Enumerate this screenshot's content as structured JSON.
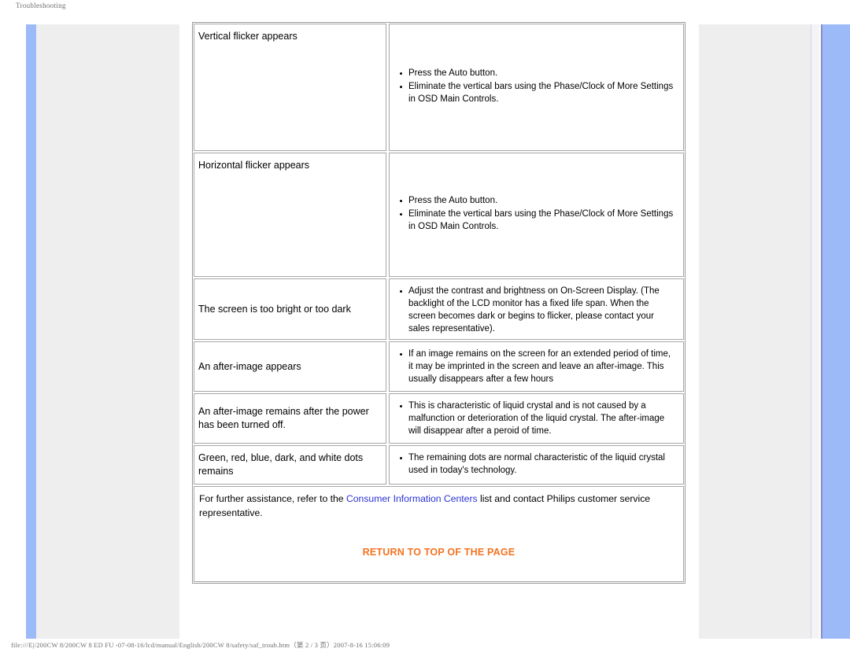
{
  "print": {
    "header": "Troubleshooting",
    "footer": "file:///E|/200CW 8/200CW 8 ED FU -07-08-16/lcd/manual/English/200CW 8/safety/saf_troub.htm（第 2 / 3 页）2007-8-16 15:06:09"
  },
  "colors": {
    "rail_blue": "#9cbaf8",
    "panel_grey": "#eeeeee",
    "link_blue": "#2b33d6",
    "return_orange": "#f37321"
  },
  "table": {
    "rows": [
      {
        "symptom": "Vertical flicker appears",
        "solutions": [
          "Press the Auto button.",
          "Eliminate the vertical bars using the Phase/Clock of More Settings in OSD Main Controls."
        ]
      },
      {
        "symptom": "Horizontal flicker appears",
        "solutions": [
          "Press the Auto button.",
          "Eliminate the vertical bars using the Phase/Clock of More Settings in OSD Main Controls."
        ]
      },
      {
        "symptom": "The screen is too bright or too dark",
        "solutions": [
          "Adjust the contrast and brightness on On-Screen Display. (The backlight of the LCD monitor has a fixed life span. When the screen becomes dark or begins to flicker, please contact your sales representative)."
        ]
      },
      {
        "symptom": "An after-image appears",
        "solutions": [
          "If an image remains on the screen for an extended period of time, it may be imprinted in the screen and leave an after-image. This usually disappears after a few hours"
        ]
      },
      {
        "symptom": "An after-image remains after the power has been turned off.",
        "solutions": [
          "This is characteristic of liquid crystal and is not caused by a malfunction or deterioration of the liquid crystal. The after-image will disappear after a peroid of time."
        ]
      },
      {
        "symptom": "Green, red, blue, dark, and white dots remains",
        "solutions": [
          "The remaining dots are normal characteristic of the liquid crystal used in today's technology."
        ]
      }
    ]
  },
  "note": {
    "lead": "For further assistance, refer to the ",
    "link_label": "Consumer Information Centers",
    "tail": " list and contact Philips customer service representative.",
    "return_label": "RETURN TO TOP OF THE PAGE"
  }
}
